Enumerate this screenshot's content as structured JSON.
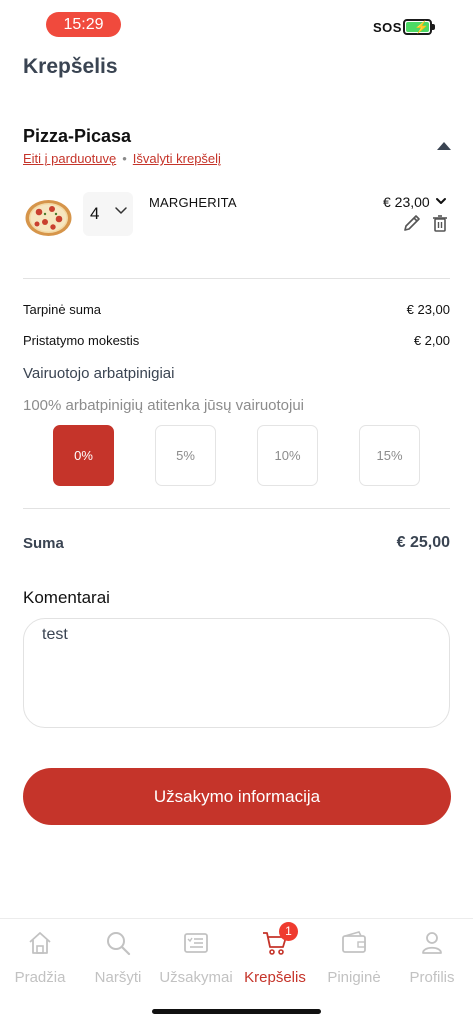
{
  "status_bar": {
    "time": "15:29",
    "sos": "SOS"
  },
  "page_title": "Krepšelis",
  "restaurant": {
    "name": "Pizza-Picasa",
    "go_to_store_label": "Eiti į parduotuvę",
    "separator": "•",
    "clear_cart_label": "Išvalyti krepšelį"
  },
  "item": {
    "quantity": "4",
    "name": "MARGHERITA",
    "price": "€ 23,00",
    "image_icon": "pizza-icon"
  },
  "summary": {
    "subtotal_label": "Tarpinė suma",
    "subtotal_value": "€ 23,00",
    "delivery_label": "Pristatymo mokestis",
    "delivery_value": "€ 2,00"
  },
  "tips": {
    "title": "Vairuotojo arbatpinigiai",
    "note": "100% arbatpinigių atitenka jūsų vairuotojui",
    "options": [
      "0%",
      "5%",
      "10%",
      "15%"
    ],
    "selected": "0%"
  },
  "total": {
    "label": "Suma",
    "value": "€ 25,00"
  },
  "comments": {
    "label": "Komentarai",
    "value": "test"
  },
  "order_button_label": "Užsakymo informacija",
  "tab_bar": {
    "tabs": [
      {
        "label": "Pradžia",
        "icon": "home-icon"
      },
      {
        "label": "Naršyti",
        "icon": "search-icon"
      },
      {
        "label": "Užsakymai",
        "icon": "orders-icon"
      },
      {
        "label": "Krepšelis",
        "icon": "cart-icon",
        "badge": "1"
      },
      {
        "label": "Piniginė",
        "icon": "wallet-icon"
      },
      {
        "label": "Profilis",
        "icon": "profile-icon"
      }
    ],
    "active": "Krepšelis"
  },
  "colors": {
    "accent": "#c5342a",
    "title": "#3a4452",
    "inactive_tab": "#c2c2c2",
    "time_pill": "#f04a3d"
  }
}
